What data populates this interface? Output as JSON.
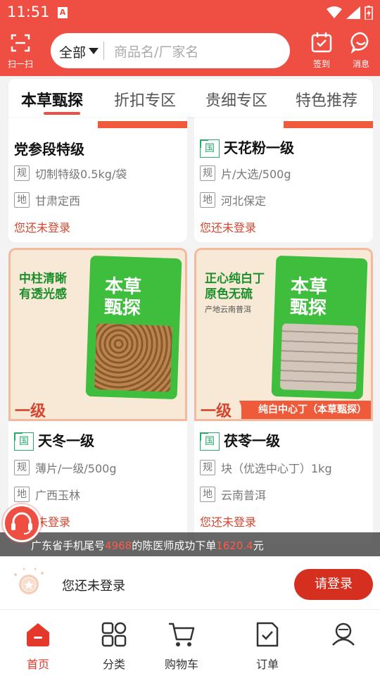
{
  "status_bar": {
    "time": "11:51",
    "app_badge": "A"
  },
  "header": {
    "scan_label": "扫一扫",
    "search": {
      "scope": "全部",
      "placeholder": "商品名/厂家名"
    },
    "checkin_label": "签到",
    "message_label": "消息"
  },
  "tabs": [
    {
      "label": "本草甄探",
      "active": true
    },
    {
      "label": "折扣专区",
      "active": false
    },
    {
      "label": "贵细专区",
      "active": false
    },
    {
      "label": "特色推荐",
      "active": false
    }
  ],
  "products": [
    {
      "name": "党参段特级",
      "has_guo": false,
      "spec_tag": "规",
      "spec": "切制特级0.5kg/袋",
      "origin_tag": "地",
      "origin": "甘肃定西",
      "login_hint": "您还未登录"
    },
    {
      "name": "天花粉一级",
      "has_guo": true,
      "guo": "国",
      "spec_tag": "规",
      "spec": "片/大选/500g",
      "origin_tag": "地",
      "origin": "河北保定",
      "login_hint": "您还未登录"
    },
    {
      "name": "天冬一级",
      "has_guo": true,
      "guo": "国",
      "spec_tag": "规",
      "spec": "薄片/一级/500g",
      "origin_tag": "地",
      "origin": "广西玉林",
      "login_hint": "您还未登录",
      "image": {
        "slogan_1": "中柱清晰",
        "slogan_2": "有透光感",
        "bag_brand_1": "本草",
        "bag_brand_2": "甄探",
        "grade": "一级"
      }
    },
    {
      "name": "茯苓一级",
      "has_guo": true,
      "guo": "国",
      "spec_tag": "规",
      "spec": "块（优选中心丁）1kg",
      "origin_tag": "地",
      "origin": "云南普洱",
      "login_hint": "您还未登录",
      "image": {
        "slogan_1": "正心纯白丁",
        "slogan_2": "原色无硫",
        "sub": "产地云南普洱",
        "bag_brand_1": "本草",
        "bag_brand_2": "甄探",
        "grade": "一级",
        "band_text": "纯白中心丁（本草甄探）"
      }
    }
  ],
  "ticker": {
    "prefix": "广东省手机尾号",
    "tail_number": "4968",
    "middle": "的陈医师成功下单",
    "amount": "1620.4",
    "suffix": "元"
  },
  "login_bar": {
    "message": "您还未登录",
    "button": "请登录"
  },
  "bottom_nav": [
    {
      "label": "首页",
      "icon": "home-icon",
      "active": true
    },
    {
      "label": "分类",
      "icon": "category-icon",
      "active": false
    },
    {
      "label": "购物车",
      "icon": "cart-icon",
      "active": false
    },
    {
      "label": "订单",
      "icon": "order-icon",
      "active": false
    },
    {
      "label": "",
      "icon": "profile-icon",
      "active": false
    }
  ],
  "colors": {
    "brand_red": "#ef4f43",
    "login_red": "#d3462f",
    "guo_green": "#2da86b",
    "bag_green": "#3fbe3d"
  }
}
